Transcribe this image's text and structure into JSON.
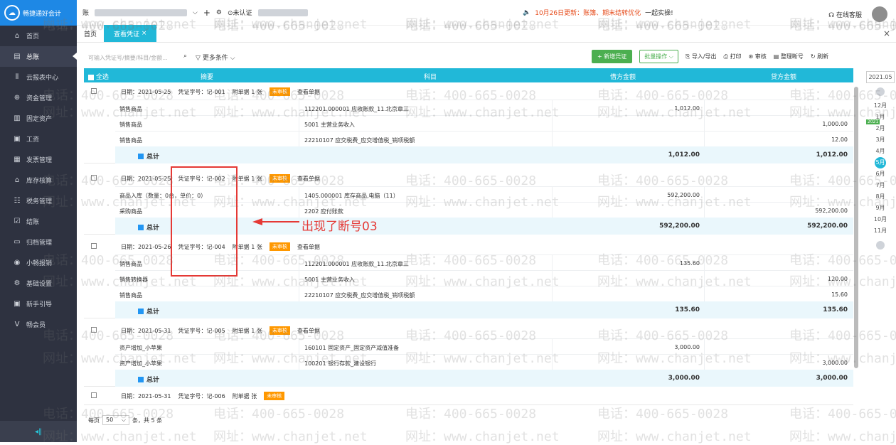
{
  "app": {
    "logo_text": "畅捷通好会计"
  },
  "topbar": {
    "company": "账",
    "auth": "未认证",
    "notice": "10月26日更新：账簿、期末结转优化",
    "notice2": "一起实操!",
    "online_service": "在线客服"
  },
  "sidebar": {
    "items": [
      {
        "label": "首页",
        "icon": "home-icon"
      },
      {
        "label": "总账",
        "icon": "ledger-icon"
      },
      {
        "label": "云报表中心",
        "icon": "report-icon"
      },
      {
        "label": "资金管理",
        "icon": "fund-icon"
      },
      {
        "label": "固定资产",
        "icon": "asset-icon"
      },
      {
        "label": "工资",
        "icon": "salary-icon"
      },
      {
        "label": "发票管理",
        "icon": "invoice-icon"
      },
      {
        "label": "库存核算",
        "icon": "stock-icon"
      },
      {
        "label": "税务管理",
        "icon": "tax-icon"
      },
      {
        "label": "结账",
        "icon": "close-account-icon"
      },
      {
        "label": "归档管理",
        "icon": "archive-icon"
      },
      {
        "label": "小畅报销",
        "icon": "expense-icon"
      },
      {
        "label": "基础设置",
        "icon": "settings-icon"
      },
      {
        "label": "新手引导",
        "icon": "guide-icon"
      },
      {
        "label": "畅会员",
        "icon": "member-icon"
      }
    ]
  },
  "tabs": [
    {
      "label": "首页"
    },
    {
      "label": "查看凭证"
    }
  ],
  "toolbar": {
    "search_placeholder": "可输入凭证号/摘要/科目/金额...",
    "more_filter": "更多条件",
    "new_voucher": "+ 新增凭证",
    "batch": "批量操作",
    "import_export": "导入/导出",
    "print": "打印",
    "audit": "审核",
    "renumber": "整理断号",
    "refresh": "刷新"
  },
  "table": {
    "headers": {
      "select_all": "全选",
      "summary": "摘要",
      "subject": "科目",
      "debit": "借方金额",
      "credit": "贷方金额"
    },
    "total_label": "总计",
    "view_docs": "查看单据",
    "vouchers": [
      {
        "date": "日期：2021-05-25",
        "no": "凭证字号：记-001",
        "attach": "附单据 1 张",
        "status": "未审核",
        "rows": [
          {
            "summary": "销售商品",
            "subject": "112201.000001 应收账款_11.北京章三",
            "debit": "1,012.00",
            "credit": ""
          },
          {
            "summary": "销售商品",
            "subject": "5001 主营业务收入",
            "debit": "",
            "credit": "1,000.00"
          },
          {
            "summary": "销售商品",
            "subject": "22210107 应交税费_应交增值税_销项税额",
            "debit": "",
            "credit": "12.00"
          }
        ],
        "total_debit": "1,012.00",
        "total_credit": "1,012.00"
      },
      {
        "date": "日期：2021-05-25",
        "no": "凭证字号：记-002",
        "attach": "附单据 1 张",
        "status": "未审核",
        "rows": [
          {
            "summary": "商品入库（数量：0台，单价：0）",
            "subject": "1405.000001 库存商品,电脑（11）",
            "debit": "592,200.00",
            "credit": ""
          },
          {
            "summary": "采购商品",
            "subject": "2202 应付账款",
            "debit": "",
            "credit": "592,200.00"
          }
        ],
        "total_debit": "592,200.00",
        "total_credit": "592,200.00"
      },
      {
        "date": "日期：2021-05-26",
        "no": "凭证字号：记-004",
        "attach": "附单据 1 张",
        "status": "未审核",
        "rows": [
          {
            "summary": "销售商品",
            "subject": "112201.000001 应收账款_11.北京章三",
            "debit": "135.60",
            "credit": ""
          },
          {
            "summary": "销售转换器",
            "subject": "5001 主营业务收入",
            "debit": "",
            "credit": "120.00"
          },
          {
            "summary": "销售商品",
            "subject": "22210107 应交税费_应交增值税_销项税额",
            "debit": "",
            "credit": "15.60"
          }
        ],
        "total_debit": "135.60",
        "total_credit": "135.60"
      },
      {
        "date": "日期：2021-05-31",
        "no": "凭证字号：记-005",
        "attach": "附单据 1 张",
        "status": "未审核",
        "rows": [
          {
            "summary": "资产增加_小苹果",
            "subject": "160101 固定资产_固定资产减值准备",
            "debit": "3,000.00",
            "credit": ""
          },
          {
            "summary": "资产增加_小苹果",
            "subject": "100201 银行存款_建设银行",
            "debit": "",
            "credit": "3,000.00"
          }
        ],
        "total_debit": "3,000.00",
        "total_credit": "3,000.00"
      },
      {
        "date": "日期：2021-05-31",
        "no": "凭证字号：记-006",
        "attach": "附单据 张",
        "status": "未审核",
        "rows": [],
        "total_debit": "",
        "total_credit": ""
      }
    ]
  },
  "period": {
    "current": "2021.05",
    "year_tag": "2021",
    "months": [
      "12月",
      "1月",
      "2月",
      "3月",
      "4月",
      "5月",
      "6月",
      "7月",
      "8月",
      "9月",
      "10月",
      "11月"
    ],
    "active": "5月"
  },
  "annotation": {
    "text": "出现了断号03"
  },
  "pager": {
    "per_page_label": "每页",
    "per_page": "50",
    "summary": "条，共 5 条"
  },
  "watermark": {
    "phone": "电话：400-665-0028",
    "site": "网址：www.chanjet.net"
  }
}
